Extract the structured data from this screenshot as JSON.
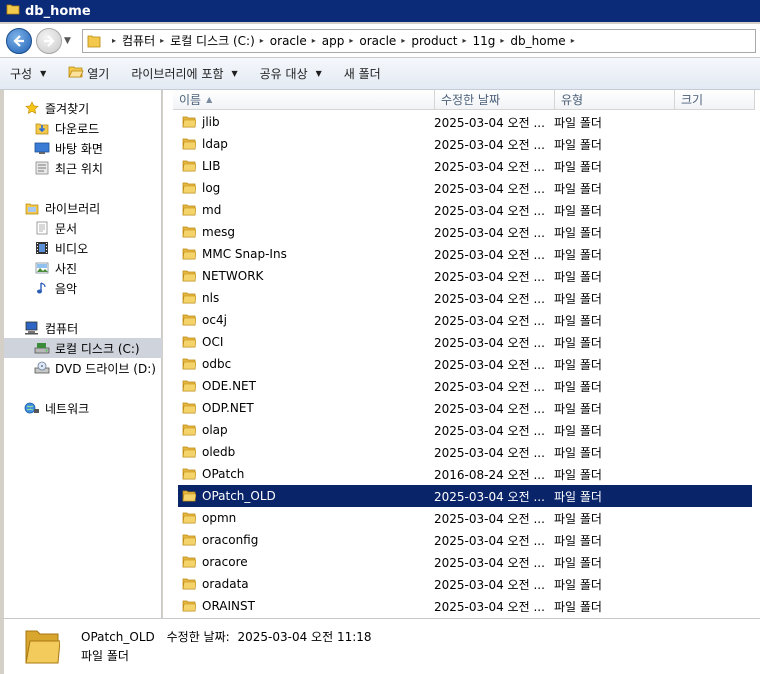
{
  "window": {
    "title": "db_home"
  },
  "address": {
    "crumbs": [
      "컴퓨터",
      "로컬 디스크 (C:)",
      "oracle",
      "app",
      "oracle",
      "product",
      "11g",
      "db_home"
    ]
  },
  "toolbar": {
    "organize": "구성",
    "open": "열기",
    "include_library": "라이브러리에 포함",
    "share_with": "공유 대상",
    "new_folder": "새 폴더"
  },
  "nav": {
    "favorites": "즐겨찾기",
    "downloads": "다운로드",
    "desktop": "바탕 화면",
    "recent": "최근 위치",
    "libraries": "라이브러리",
    "documents": "문서",
    "videos": "비디오",
    "pictures": "사진",
    "music": "음악",
    "computer": "컴퓨터",
    "local_disk": "로컬 디스크 (C:)",
    "dvd_drive": "DVD 드라이브 (D:)",
    "network": "네트워크"
  },
  "columns": {
    "name": "이름",
    "modified": "수정한 날짜",
    "type": "유형",
    "size": "크기"
  },
  "files": [
    {
      "name": "jlib",
      "date": "2025-03-04 오전 ...",
      "type": "파일 폴더"
    },
    {
      "name": "ldap",
      "date": "2025-03-04 오전 ...",
      "type": "파일 폴더"
    },
    {
      "name": "LIB",
      "date": "2025-03-04 오전 ...",
      "type": "파일 폴더"
    },
    {
      "name": "log",
      "date": "2025-03-04 오전 ...",
      "type": "파일 폴더"
    },
    {
      "name": "md",
      "date": "2025-03-04 오전 ...",
      "type": "파일 폴더"
    },
    {
      "name": "mesg",
      "date": "2025-03-04 오전 ...",
      "type": "파일 폴더"
    },
    {
      "name": "MMC Snap-Ins",
      "date": "2025-03-04 오전 ...",
      "type": "파일 폴더"
    },
    {
      "name": "NETWORK",
      "date": "2025-03-04 오전 ...",
      "type": "파일 폴더"
    },
    {
      "name": "nls",
      "date": "2025-03-04 오전 ...",
      "type": "파일 폴더"
    },
    {
      "name": "oc4j",
      "date": "2025-03-04 오전 ...",
      "type": "파일 폴더"
    },
    {
      "name": "OCI",
      "date": "2025-03-04 오전 ...",
      "type": "파일 폴더"
    },
    {
      "name": "odbc",
      "date": "2025-03-04 오전 ...",
      "type": "파일 폴더"
    },
    {
      "name": "ODE.NET",
      "date": "2025-03-04 오전 ...",
      "type": "파일 폴더"
    },
    {
      "name": "ODP.NET",
      "date": "2025-03-04 오전 ...",
      "type": "파일 폴더"
    },
    {
      "name": "olap",
      "date": "2025-03-04 오전 ...",
      "type": "파일 폴더"
    },
    {
      "name": "oledb",
      "date": "2025-03-04 오전 ...",
      "type": "파일 폴더"
    },
    {
      "name": "OPatch",
      "date": "2016-08-24 오전 ...",
      "type": "파일 폴더"
    },
    {
      "name": "OPatch_OLD",
      "date": "2025-03-04 오전 ...",
      "type": "파일 폴더",
      "selected": true
    },
    {
      "name": "opmn",
      "date": "2025-03-04 오전 ...",
      "type": "파일 폴더"
    },
    {
      "name": "oraconfig",
      "date": "2025-03-04 오전 ...",
      "type": "파일 폴더"
    },
    {
      "name": "oracore",
      "date": "2025-03-04 오전 ...",
      "type": "파일 폴더"
    },
    {
      "name": "oradata",
      "date": "2025-03-04 오전 ...",
      "type": "파일 폴더"
    },
    {
      "name": "ORAINST",
      "date": "2025-03-04 오전 ...",
      "type": "파일 폴더"
    }
  ],
  "details": {
    "name": "OPatch_OLD",
    "modified_label": "수정한 날짜:",
    "modified_value": "2025-03-04 오전 11:18",
    "type": "파일 폴더"
  },
  "colors": {
    "titlebar": "#0b2a78",
    "selection": "#0a246a",
    "folder": "#e8b845"
  }
}
